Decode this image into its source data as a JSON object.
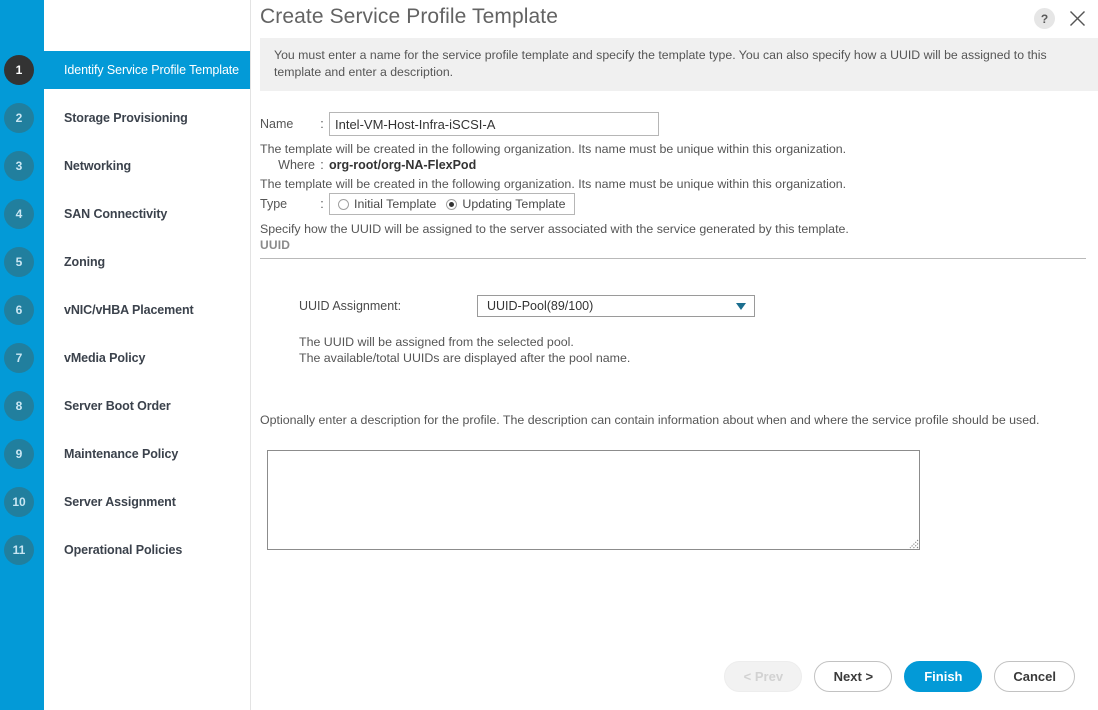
{
  "wizard": {
    "steps": [
      {
        "number": "1",
        "label": "Identify Service Profile Template",
        "active": true
      },
      {
        "number": "2",
        "label": "Storage Provisioning",
        "active": false
      },
      {
        "number": "3",
        "label": "Networking",
        "active": false
      },
      {
        "number": "4",
        "label": "SAN Connectivity",
        "active": false
      },
      {
        "number": "5",
        "label": "Zoning",
        "active": false
      },
      {
        "number": "6",
        "label": "vNIC/vHBA Placement",
        "active": false
      },
      {
        "number": "7",
        "label": "vMedia Policy",
        "active": false
      },
      {
        "number": "8",
        "label": "Server Boot Order",
        "active": false
      },
      {
        "number": "9",
        "label": "Maintenance Policy",
        "active": false
      },
      {
        "number": "10",
        "label": "Server Assignment",
        "active": false
      },
      {
        "number": "11",
        "label": "Operational Policies",
        "active": false
      }
    ]
  },
  "titlebar": {
    "title": "Create Service Profile Template",
    "help_label": "?",
    "help_icon": "question-mark-icon",
    "close_icon": "close-icon"
  },
  "banner": {
    "text": "You must enter a name for the service profile template and specify the template type. You can also specify how a UUID will be assigned to this template and enter a description."
  },
  "form": {
    "name_label": "Name",
    "colon": ":",
    "name_value": "Intel-VM-Host-Infra-iSCSI-A",
    "name_placeholder": "",
    "org_line_1": "The template will be created in the following organization. Its name must be unique within this organization.",
    "where_label": "Where",
    "where_value": "org-root/org-NA-FlexPod",
    "org_line_2": "The template will be created in the following organization. Its name must be unique within this organization.",
    "type_label": "Type",
    "type_options": [
      {
        "label": "Initial Template",
        "checked": false
      },
      {
        "label": "Updating Template",
        "checked": true
      }
    ],
    "uuid_help": "Specify how the UUID will be assigned to the server associated with the service generated by this template.",
    "uuid_section_header": "UUID",
    "uuid_assignment_label": "UUID Assignment:",
    "uuid_assignment_value": "UUID-Pool(89/100)",
    "uuid_caret_icon": "chevron-down-icon",
    "uuid_note_1": "The UUID will be assigned from the selected pool.",
    "uuid_note_2": "The available/total UUIDs are displayed after the pool name.",
    "description_help": "Optionally enter a description for the profile. The description can contain information about when and where the service profile should be used.",
    "description_value": "",
    "description_placeholder": ""
  },
  "footer": {
    "buttons": [
      {
        "label": "< Prev",
        "style": "disabled"
      },
      {
        "label": "Next >",
        "style": "default"
      },
      {
        "label": "Finish",
        "style": "primary"
      },
      {
        "label": "Cancel",
        "style": "default"
      }
    ]
  },
  "colors": {
    "accent_blue": "#039ad7",
    "step_inactive": "#217f9e",
    "step_active": "#333333",
    "banner_bg": "#f0f0f0",
    "text_gray": "#555555"
  }
}
